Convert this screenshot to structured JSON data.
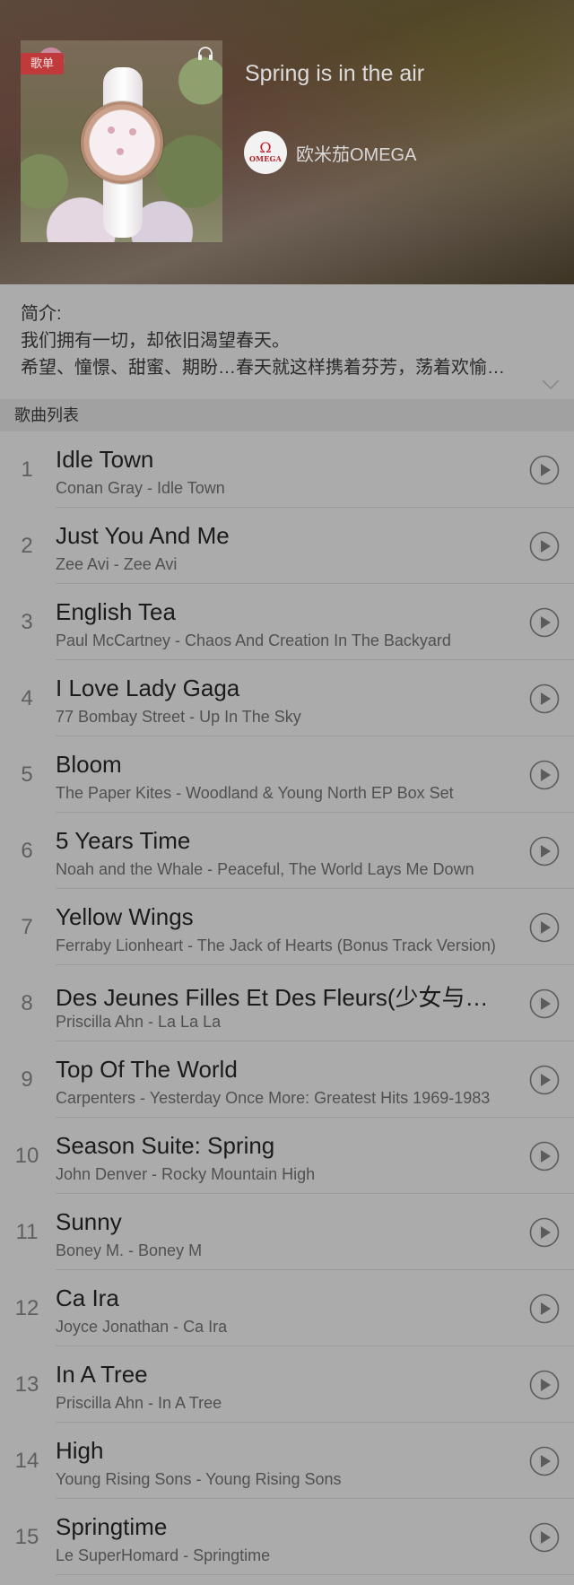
{
  "playlist": {
    "badge": "歌单",
    "title": "Spring is in the air",
    "author": "欧米茄OMEGA",
    "avatar_symbol": "Ω",
    "avatar_text": "OMEGA",
    "icons": {
      "headphone": "headphone-icon",
      "expand": "chevron-down-icon",
      "play": "play-circle-icon"
    }
  },
  "intro": {
    "label": "简介:",
    "line1": "我们拥有一切，却依旧渴望春天。",
    "line2": "希望、憧憬、甜蜜、期盼…春天就这样携着芬芳，荡着欢愉…"
  },
  "section": {
    "title": "歌曲列表"
  },
  "songs": [
    {
      "num": "1",
      "name": "Idle Town",
      "meta": "Conan Gray - Idle Town"
    },
    {
      "num": "2",
      "name": "Just You And Me",
      "meta": "Zee Avi - Zee Avi"
    },
    {
      "num": "3",
      "name": "English Tea",
      "meta": "Paul McCartney - Chaos And Creation In The Backyard"
    },
    {
      "num": "4",
      "name": "I Love Lady Gaga",
      "meta": "77 Bombay Street - Up In The Sky"
    },
    {
      "num": "5",
      "name": "Bloom",
      "meta": "The Paper Kites - Woodland & Young North EP Box Set"
    },
    {
      "num": "6",
      "name": "5 Years Time",
      "meta": "Noah and the Whale - Peaceful, The World Lays Me Down"
    },
    {
      "num": "7",
      "name": "Yellow Wings",
      "meta": "Ferraby Lionheart - The Jack of Hearts (Bonus Track Version)"
    },
    {
      "num": "8",
      "name": "Des Jeunes Filles Et Des Fleurs(少女与…",
      "meta": "Priscilla Ahn - La La La"
    },
    {
      "num": "9",
      "name": "Top Of The World",
      "meta": "Carpenters - Yesterday Once More: Greatest Hits 1969-1983"
    },
    {
      "num": "10",
      "name": "Season Suite: Spring",
      "meta": "John Denver - Rocky Mountain High"
    },
    {
      "num": "11",
      "name": "Sunny",
      "meta": "Boney M. - Boney M"
    },
    {
      "num": "12",
      "name": "Ca Ira",
      "meta": "Joyce Jonathan - Ca Ira"
    },
    {
      "num": "13",
      "name": "In A Tree",
      "meta": "Priscilla Ahn - In A Tree"
    },
    {
      "num": "14",
      "name": "High",
      "meta": "Young Rising Sons - Young Rising Sons"
    },
    {
      "num": "15",
      "name": "Springtime",
      "meta": "Le SuperHomard - Springtime"
    }
  ]
}
